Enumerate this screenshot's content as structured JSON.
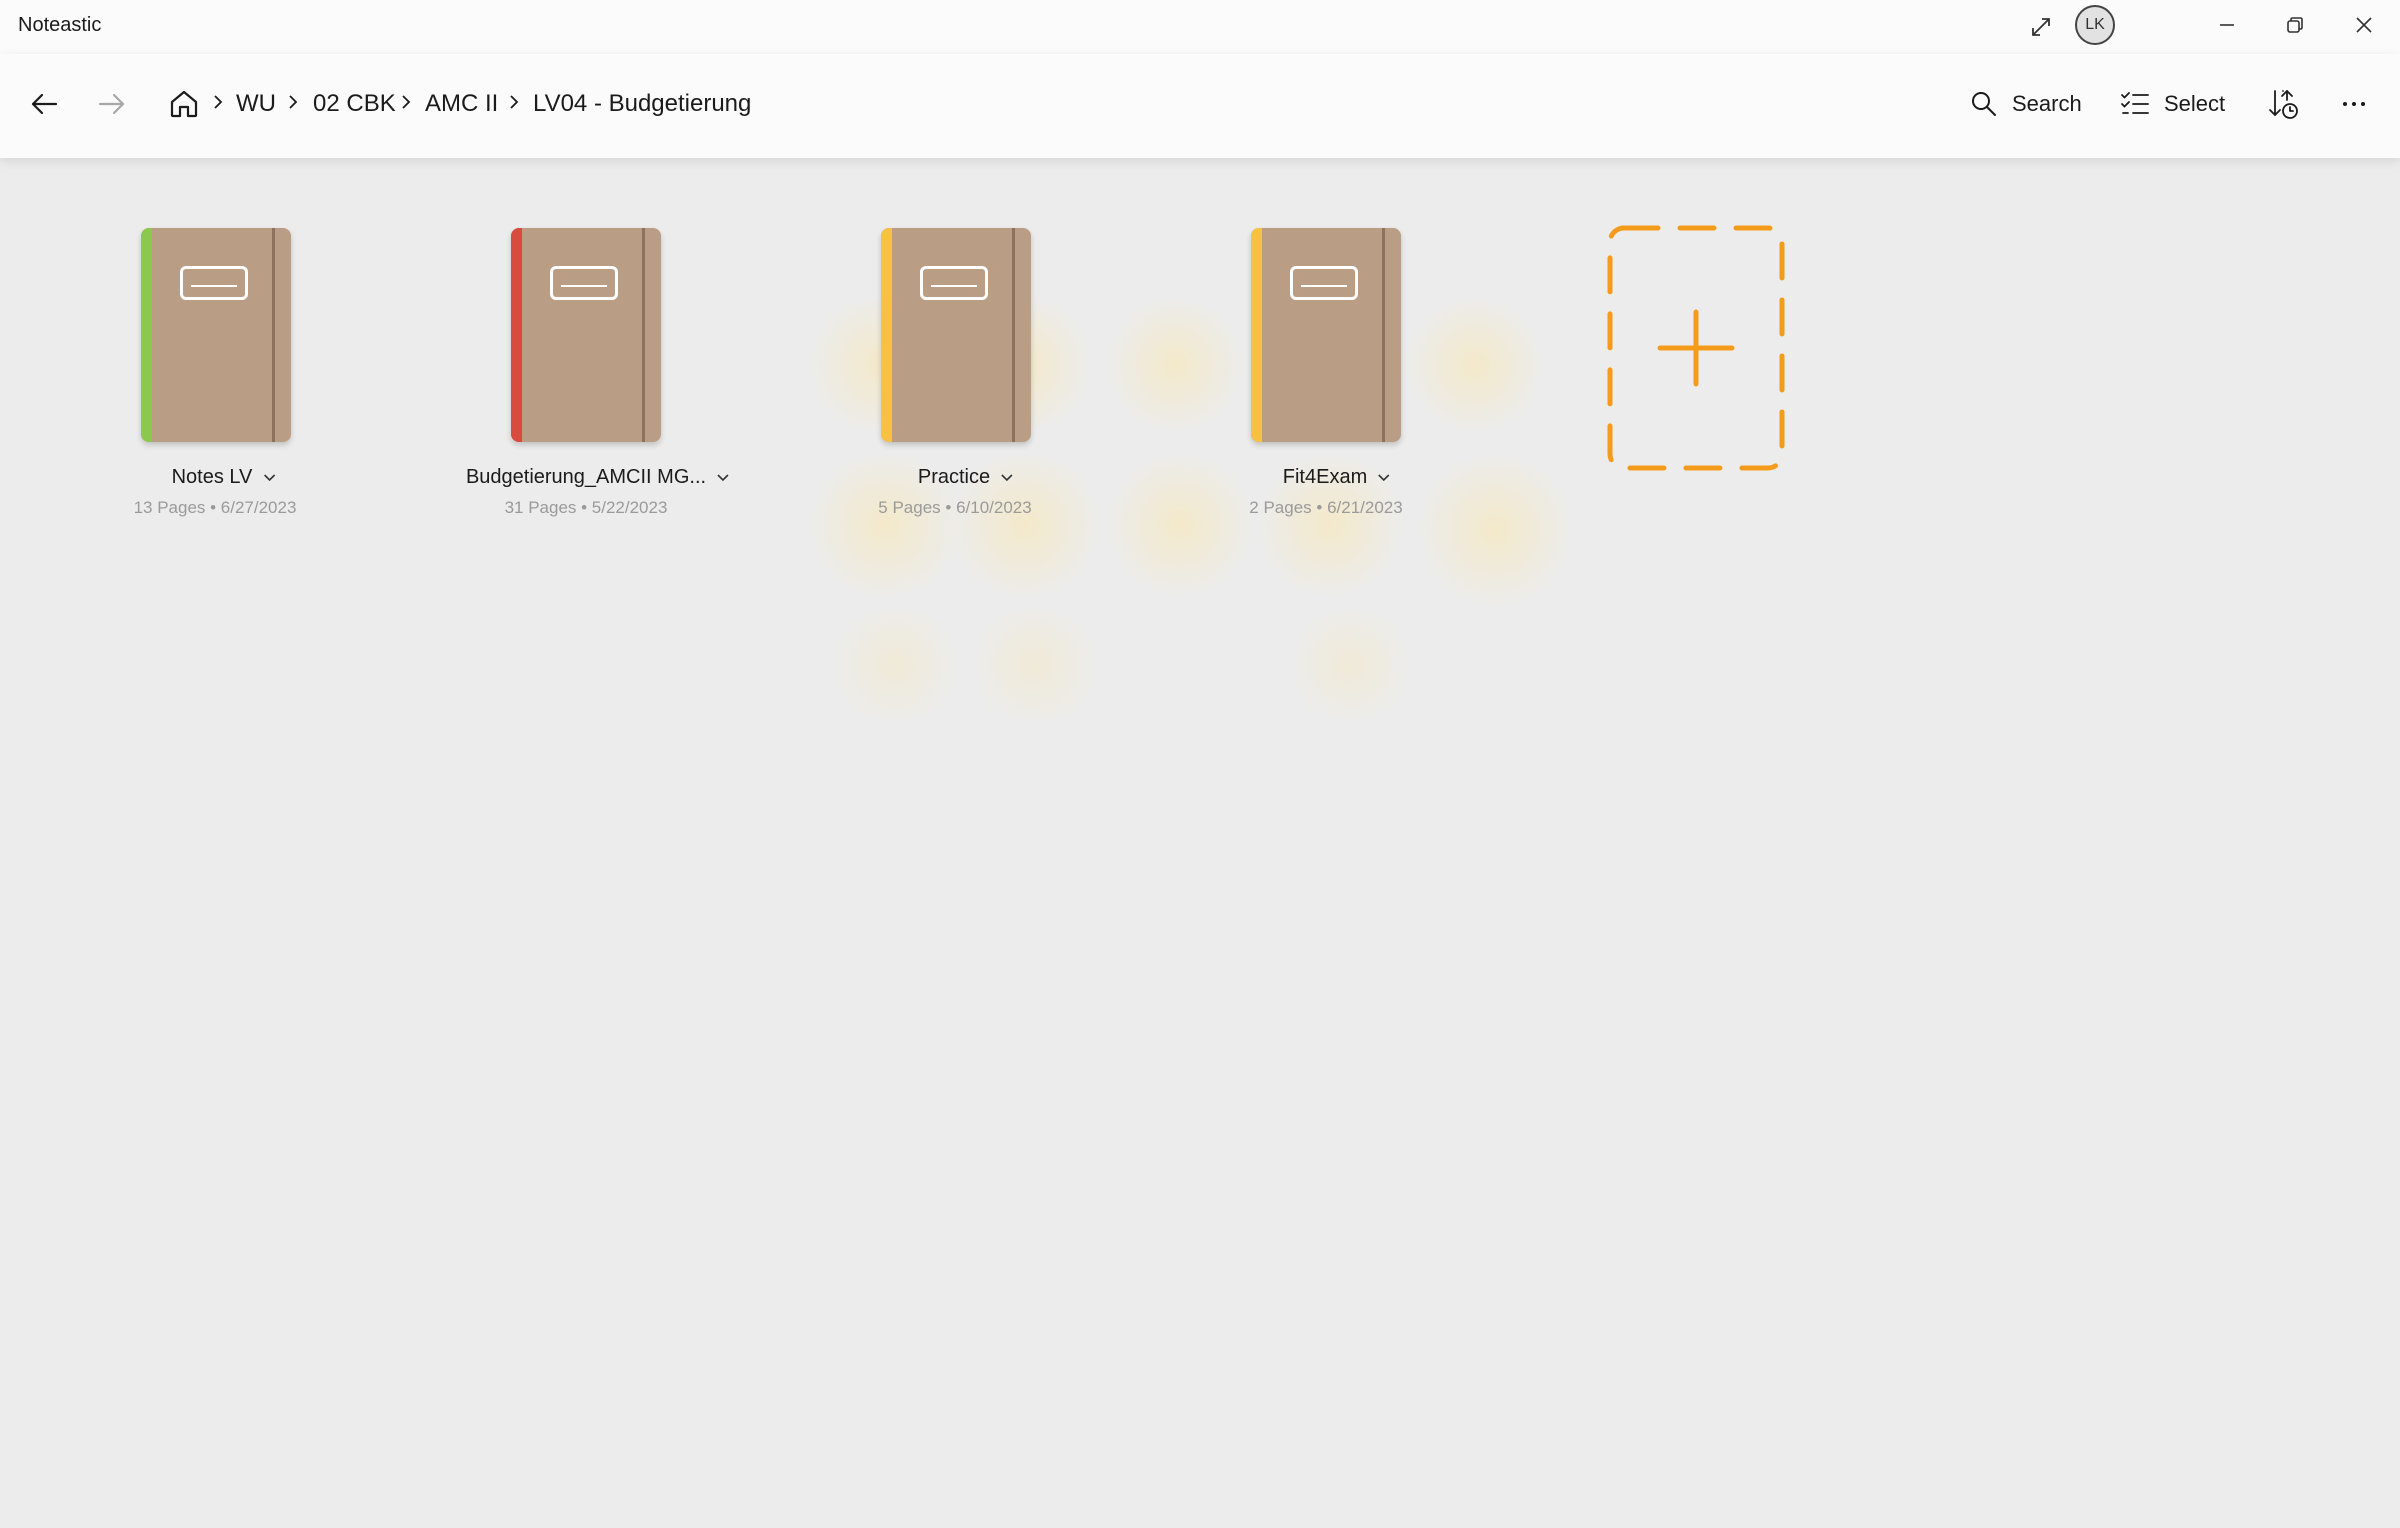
{
  "app": {
    "title": "Noteastic"
  },
  "titlebar": {
    "avatar_initials": "LK",
    "icons": [
      "expand-icon",
      "minimize-icon",
      "restore-icon",
      "close-icon"
    ]
  },
  "breadcrumb": {
    "items": [
      "WU",
      "02 CBK",
      "AMC II",
      "LV04 - Budgetierung"
    ]
  },
  "toolbar": {
    "search_label": "Search",
    "select_label": "Select"
  },
  "colors": {
    "accent": "#f59b1c",
    "cover": "#b99d85",
    "spine_green": "#8cc84b",
    "spine_red": "#d94a3f",
    "spine_yellow": "#f5c242"
  },
  "notebooks": [
    {
      "title": "Notes LV",
      "meta": "13 Pages • 6/27/2023",
      "spine": "#8cc84b"
    },
    {
      "title": "Budgetierung_AMCII MG...",
      "meta": "31 Pages • 5/22/2023",
      "spine": "#d94a3f"
    },
    {
      "title": "Practice",
      "meta": "5 Pages • 6/10/2023",
      "spine": "#f5c242"
    },
    {
      "title": "Fit4Exam",
      "meta": "2 Pages • 6/21/2023",
      "spine": "#f5c242"
    }
  ]
}
